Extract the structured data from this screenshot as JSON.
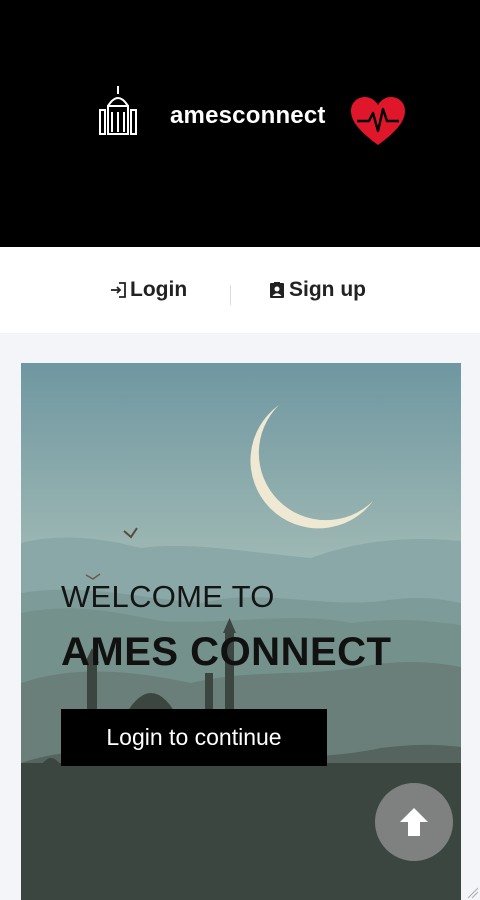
{
  "header": {
    "brand_name": "amesconnect",
    "logo_icon": "crescent-mosque-icon",
    "heart_icon": "heartbeat-icon",
    "heart_color": "#e0162b"
  },
  "auth": {
    "login_label": "Login",
    "signup_label": "Sign up",
    "login_icon": "login-arrow-icon",
    "signup_icon": "contact-card-icon"
  },
  "hero": {
    "welcome_text": "WELCOME TO",
    "brand_heading": "AMES CONNECT",
    "cta_label": "Login to continue",
    "scroll_icon": "arrow-up-icon"
  }
}
